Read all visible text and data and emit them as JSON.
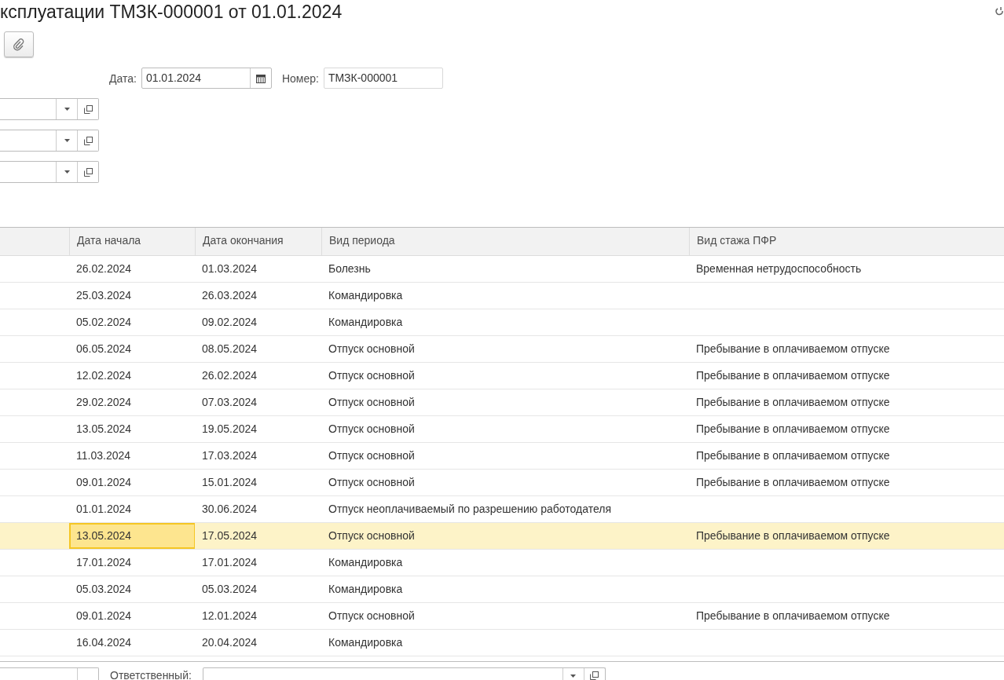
{
  "window": {
    "title": "ксплуатации ТМЗК-000001 от 01.01.2024"
  },
  "header_fields": {
    "date": {
      "label": "Дата:",
      "value": "01.01.2024"
    },
    "number": {
      "label": "Номер:",
      "value": "ТМЗК-000001"
    }
  },
  "reference_fields": [
    {
      "kind": "select"
    },
    {
      "kind": "select"
    },
    {
      "kind": "select"
    }
  ],
  "table": {
    "columns": [
      "Дата начала",
      "Дата окончания",
      "Вид периода",
      "Вид стажа ПФР"
    ],
    "rows": [
      {
        "cells": [
          "26.02.2024",
          "01.03.2024",
          "Болезнь",
          "Временная нетрудоспособность"
        ],
        "selected": false
      },
      {
        "cells": [
          "25.03.2024",
          "26.03.2024",
          "Командировка",
          ""
        ],
        "selected": false
      },
      {
        "cells": [
          "05.02.2024",
          "09.02.2024",
          "Командировка",
          ""
        ],
        "selected": false
      },
      {
        "cells": [
          "06.05.2024",
          "08.05.2024",
          "Отпуск основной",
          "Пребывание в оплачиваемом отпуске"
        ],
        "selected": false
      },
      {
        "cells": [
          "12.02.2024",
          "26.02.2024",
          "Отпуск основной",
          "Пребывание в оплачиваемом отпуске"
        ],
        "selected": false
      },
      {
        "cells": [
          "29.02.2024",
          "07.03.2024",
          "Отпуск основной",
          "Пребывание в оплачиваемом отпуске"
        ],
        "selected": false
      },
      {
        "cells": [
          "13.05.2024",
          "19.05.2024",
          "Отпуск основной",
          "Пребывание в оплачиваемом отпуске"
        ],
        "selected": false
      },
      {
        "cells": [
          "11.03.2024",
          "17.03.2024",
          "Отпуск основной",
          "Пребывание в оплачиваемом отпуске"
        ],
        "selected": false
      },
      {
        "cells": [
          "09.01.2024",
          "15.01.2024",
          "Отпуск основной",
          "Пребывание в оплачиваемом отпуске"
        ],
        "selected": false
      },
      {
        "cells": [
          "01.01.2024",
          "30.06.2024",
          "Отпуск неоплачиваемый по разрешению работодателя",
          ""
        ],
        "selected": false
      },
      {
        "cells": [
          "13.05.2024",
          "17.05.2024",
          "Отпуск основной",
          "Пребывание в оплачиваемом отпуске"
        ],
        "selected": true
      },
      {
        "cells": [
          "17.01.2024",
          "17.01.2024",
          "Командировка",
          ""
        ],
        "selected": false
      },
      {
        "cells": [
          "05.03.2024",
          "05.03.2024",
          "Командировка",
          ""
        ],
        "selected": false
      },
      {
        "cells": [
          "09.01.2024",
          "12.01.2024",
          "Отпуск основной",
          "Пребывание в оплачиваемом отпуске"
        ],
        "selected": false
      },
      {
        "cells": [
          "16.04.2024",
          "20.04.2024",
          "Командировка",
          ""
        ],
        "selected": false
      }
    ]
  },
  "footer": {
    "responsible_label": "Ответственный:"
  }
}
